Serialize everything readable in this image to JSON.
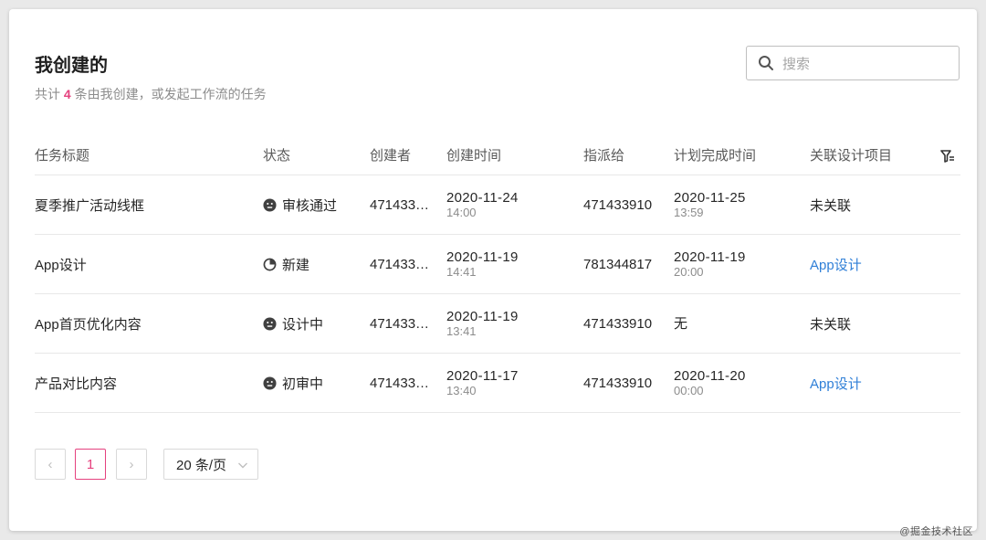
{
  "page": {
    "title": "我创建的",
    "subtitle_prefix": "共计",
    "subtitle_count": "4",
    "subtitle_suffix": "条由我创建，或发起工作流的任务",
    "search_placeholder": "搜索",
    "accent_color": "#e5417e",
    "link_color": "#2f7fd7"
  },
  "table": {
    "columns": [
      "任务标题",
      "状态",
      "创建者",
      "创建时间",
      "指派给",
      "计划完成时间",
      "关联设计项目"
    ],
    "filter_icon": "filter-icon",
    "rows": [
      {
        "title": "夏季推广活动线框",
        "status": "审核通过",
        "status_icon": "face-icon",
        "creator": "471433…",
        "created_date": "2020-11-24",
        "created_time": "14:00",
        "assignee": "471433910",
        "plan_date": "2020-11-25",
        "plan_time": "13:59",
        "project": "未关联",
        "project_linked": false
      },
      {
        "title": "App设计",
        "status": "新建",
        "status_icon": "pie-icon",
        "creator": "471433…",
        "created_date": "2020-11-19",
        "created_time": "14:41",
        "assignee": "781344817",
        "plan_date": "2020-11-19",
        "plan_time": "20:00",
        "project": "App设计",
        "project_linked": true
      },
      {
        "title": "App首页优化内容",
        "status": "设计中",
        "status_icon": "face-icon",
        "creator": "471433…",
        "created_date": "2020-11-19",
        "created_time": "13:41",
        "assignee": "471433910",
        "plan_date": "无",
        "plan_time": "",
        "project": "未关联",
        "project_linked": false
      },
      {
        "title": "产品对比内容",
        "status": "初审中",
        "status_icon": "face-icon",
        "creator": "471433…",
        "created_date": "2020-11-17",
        "created_time": "13:40",
        "assignee": "471433910",
        "plan_date": "2020-11-20",
        "plan_time": "00:00",
        "project": "App设计",
        "project_linked": true
      }
    ]
  },
  "pagination": {
    "prev": "‹",
    "current_page": "1",
    "next": "›",
    "page_size": "20 条/页"
  },
  "watermark": "@掘金技术社区"
}
